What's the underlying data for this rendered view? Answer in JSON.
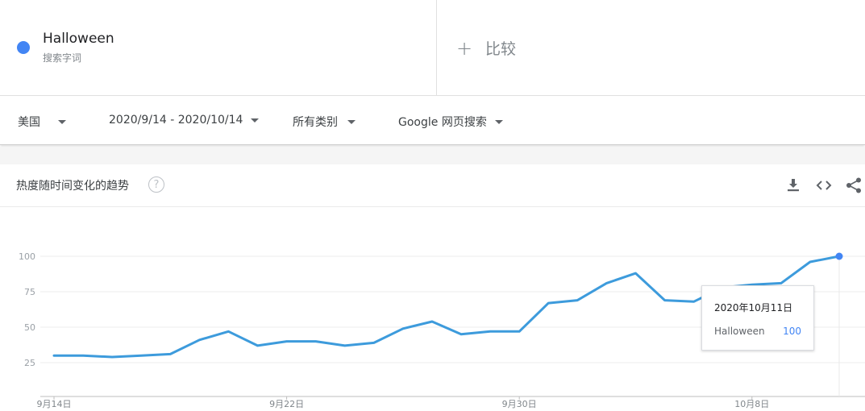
{
  "term": {
    "name": "Halloween",
    "type": "搜索字词",
    "color": "#4285f4"
  },
  "compare": {
    "plus": "+",
    "label": "比较"
  },
  "filters": {
    "region": "美国",
    "date_range": "2020/9/14 - 2020/10/14",
    "category": "所有类别",
    "property": "Google 网页搜索"
  },
  "card": {
    "title": "热度随时间变化的趋势",
    "help": "?",
    "icons": [
      "download-icon",
      "embed-icon",
      "share-icon"
    ]
  },
  "tooltip": {
    "date": "2020年10月11日",
    "term": "Halloween",
    "value": "100"
  },
  "chart_data": {
    "type": "line",
    "x": [
      "2020-09-14",
      "2020-09-15",
      "2020-09-16",
      "2020-09-17",
      "2020-09-18",
      "2020-09-19",
      "2020-09-20",
      "2020-09-21",
      "2020-09-22",
      "2020-09-23",
      "2020-09-24",
      "2020-09-25",
      "2020-09-26",
      "2020-09-27",
      "2020-09-28",
      "2020-09-29",
      "2020-09-30",
      "2020-10-01",
      "2020-10-02",
      "2020-10-03",
      "2020-10-04",
      "2020-10-05",
      "2020-10-06",
      "2020-10-07",
      "2020-10-08",
      "2020-10-09",
      "2020-10-10",
      "2020-10-11"
    ],
    "series": [
      {
        "values": [
          30,
          30,
          29,
          30,
          31,
          41,
          47,
          37,
          40,
          40,
          37,
          39,
          49,
          54,
          45,
          47,
          47,
          67,
          69,
          81,
          88,
          69,
          68,
          78,
          80,
          81,
          96,
          100
        ]
      }
    ],
    "x_tick_labels": [
      "9月14日",
      "9月22日",
      "9月30日",
      "10月8日"
    ],
    "x_tick_dates": [
      "2020-09-14",
      "2020-09-22",
      "2020-09-30",
      "2020-10-08"
    ],
    "y_ticks": [
      25,
      50,
      75,
      100
    ],
    "ylim": [
      0,
      100
    ],
    "grid": true,
    "line_color": "#3d9bdc",
    "highlight_date": "2020-10-11"
  }
}
